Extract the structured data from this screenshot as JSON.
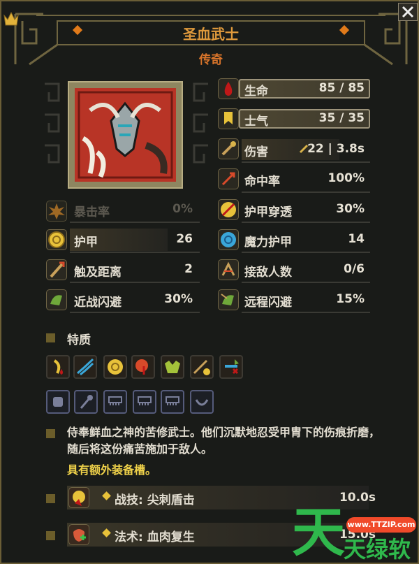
{
  "unit": {
    "name": "圣血武士",
    "rarity": "传奇"
  },
  "stats_left": [
    {
      "label": "暴击率",
      "value": "0%",
      "icon": "crit-icon",
      "dim": true
    },
    {
      "label": "护甲",
      "value": "26",
      "icon": "armor-icon"
    },
    {
      "label": "触及距离",
      "value": "2",
      "icon": "reach-icon"
    },
    {
      "label": "近战闪避",
      "value": "30%",
      "icon": "melee-dodge-icon"
    }
  ],
  "stats_right": [
    {
      "label": "生命",
      "value": "85 / 85",
      "icon": "blood-drop-icon"
    },
    {
      "label": "士气",
      "value": "35 / 35",
      "icon": "morale-banner-icon"
    },
    {
      "label": "伤害",
      "value": "22 | 3.8s",
      "icon": "damage-icon"
    },
    {
      "label": "命中率",
      "value": "100%",
      "icon": "accuracy-icon"
    },
    {
      "label": "护甲穿透",
      "value": "30%",
      "icon": "armor-pierce-icon"
    },
    {
      "label": "魔力护甲",
      "value": "14",
      "icon": "magic-armor-icon"
    },
    {
      "label": "接敌人数",
      "value": "0/6",
      "icon": "engage-icon"
    },
    {
      "label": "远程闪避",
      "value": "15%",
      "icon": "ranged-dodge-icon"
    }
  ],
  "traits": {
    "title": "特质",
    "icons": [
      "bleed-icon",
      "claw-icon",
      "armor-icon",
      "pierce-icon",
      "strength-icon",
      "ranged-icon",
      "flag-icon"
    ]
  },
  "equipment_slots": [
    "slot-empty-icon",
    "mace-icon",
    "banner-icon",
    "banner-icon",
    "banner-icon",
    "crescent-icon"
  ],
  "description": "侍奉鲜血之神的苦修武士。他们沉默地忍受甲胄下的伤痕折磨，随后将这份痛苦施加于敌人。",
  "extra_slot": "具有额外装备槽。",
  "abilities": [
    {
      "label": "战技: 尖刺盾击",
      "cooldown": "10.0s",
      "icon": "spike-shield-icon"
    },
    {
      "label": "法术: 血肉复生",
      "cooldown": "15.0s",
      "icon": "flesh-regen-icon"
    }
  ],
  "watermark": {
    "site": "www.TTZIP.com",
    "big": "天",
    "text": "天绿软"
  },
  "colors": {
    "gold": "#d9a54a",
    "bg": "#191b18",
    "watermark": "#2fb84c"
  }
}
